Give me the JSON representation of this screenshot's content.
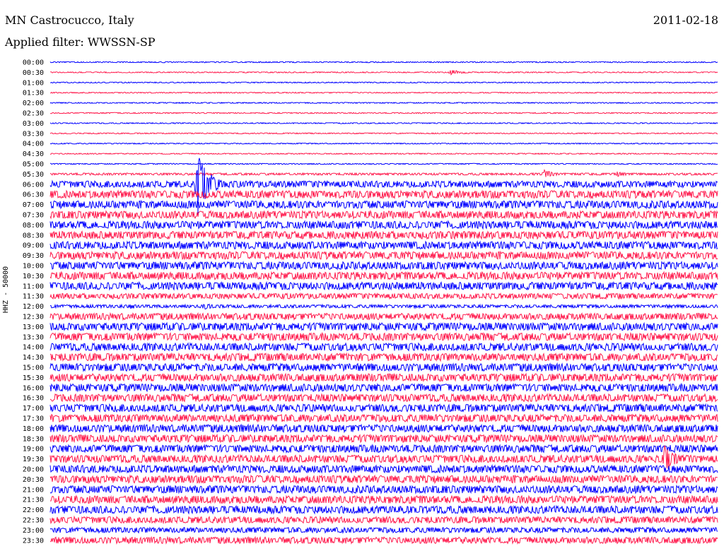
{
  "header": {
    "station": "MN Castrocucco, Italy",
    "date": "2011-02-18",
    "filter": "Applied filter: WWSSN-SP"
  },
  "colors": {
    "odd_trace": "#0000ff",
    "even_trace": "#ff1a4d"
  },
  "chart_data": {
    "type": "line",
    "subtype": "helicorder",
    "ylabel": "HHZ - 50000",
    "tick_labels": [
      "00:00",
      "00:30",
      "01:00",
      "01:30",
      "02:00",
      "02:30",
      "03:00",
      "03:30",
      "04:00",
      "04:30",
      "05:00",
      "05:30",
      "06:00",
      "06:30",
      "07:00",
      "07:30",
      "08:00",
      "08:30",
      "09:00",
      "09:30",
      "10:00",
      "10:30",
      "11:00",
      "11:30",
      "12:00",
      "12:30",
      "13:00",
      "13:30",
      "14:00",
      "14:30",
      "15:00",
      "15:30",
      "16:00",
      "16:30",
      "17:00",
      "17:30",
      "18:00",
      "18:30",
      "19:00",
      "19:30",
      "20:00",
      "20:30",
      "21:00",
      "21:30",
      "22:00",
      "22:30",
      "23:00",
      "23:30"
    ],
    "noise_level": [
      1,
      1,
      1,
      1,
      1,
      1,
      1,
      1,
      1,
      1,
      1,
      2,
      6,
      7,
      7,
      7,
      7,
      7,
      7,
      7,
      7,
      7,
      7,
      5,
      3,
      6,
      7,
      7,
      7,
      7,
      7,
      7,
      7,
      7,
      7,
      7,
      7,
      7,
      7,
      7,
      7,
      7,
      7,
      7,
      7,
      6,
      5,
      6
    ],
    "events": [
      {
        "row": "00:30",
        "at": 0.6,
        "amp": 8
      },
      {
        "row": "06:00",
        "at": 0.22,
        "amp": 100
      },
      {
        "row": "05:30",
        "at": 0.74,
        "amp": 12
      },
      {
        "row": "05:30",
        "at": 0.85,
        "amp": 8
      },
      {
        "row": "11:30",
        "at": 0.72,
        "amp": 6
      },
      {
        "row": "12:00",
        "at": 0.12,
        "amp": 8
      },
      {
        "row": "12:00",
        "at": 0.23,
        "amp": 10
      },
      {
        "row": "19:30",
        "at": 0.92,
        "amp": 40
      },
      {
        "row": "22:00",
        "at": 0.51,
        "amp": 10
      }
    ],
    "grid": false
  }
}
